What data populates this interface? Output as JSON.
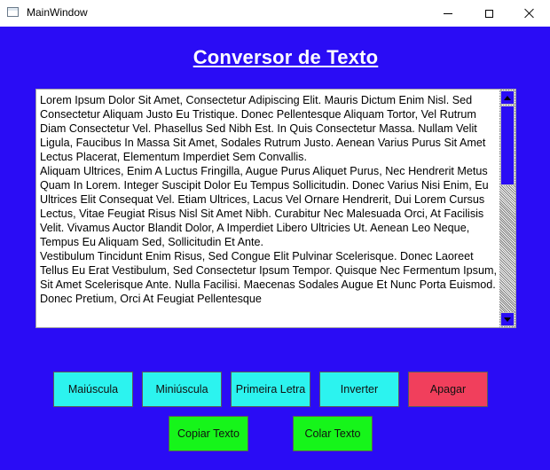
{
  "window": {
    "title": "MainWindow"
  },
  "app": {
    "title": "Conversor de Texto",
    "background_color": "#2a0cf5"
  },
  "editor": {
    "text": "Lorem Ipsum Dolor Sit Amet, Consectetur Adipiscing Elit. Mauris Dictum Enim Nisl. Sed Consectetur Aliquam Justo Eu Tristique. Donec Pellentesque Aliquam Tortor, Vel Rutrum Diam Consectetur Vel. Phasellus Sed Nibh Est. In Quis Consectetur Massa. Nullam Velit Ligula, Faucibus In Massa Sit Amet, Sodales Rutrum Justo. Aenean Varius Purus Sit Amet Lectus Placerat, Elementum Imperdiet Sem Convallis.\nAliquam Ultrices, Enim A Luctus Fringilla, Augue Purus Aliquet Purus, Nec Hendrerit Metus Quam In Lorem. Integer Suscipit Dolor Eu Tempus Sollicitudin. Donec Varius Nisi Enim, Eu Ultrices Elit Consequat Vel. Etiam Ultrices, Lacus Vel Ornare Hendrerit, Dui Lorem Cursus Lectus, Vitae Feugiat Risus Nisl Sit Amet Nibh. Curabitur Nec Malesuada Orci, At Facilisis Velit. Vivamus Auctor Blandit Dolor, A Imperdiet Libero Ultricies Ut. Aenean Leo Neque, Tempus Eu Aliquam Sed, Sollicitudin Et Ante.\nVestibulum Tincidunt Enim Risus, Sed Congue Elit Pulvinar Scelerisque. Donec Laoreet Tellus Eu Erat Vestibulum, Sed Consectetur Ipsum Tempor. Quisque Nec Fermentum Ipsum, Sit Amet Scelerisque Ante. Nulla Facilisi. Maecenas Sodales Augue Et Nunc Porta Euismod. Donec Pretium, Orci At Feugiat Pellentesque"
  },
  "buttons": {
    "maiuscula": "Maiúscula",
    "minuscula": "Miniúscula",
    "primeira_letra": "Primeira Letra",
    "inverter": "Inverter",
    "apagar": "Apagar",
    "copiar": "Copiar Texto",
    "colar": "Colar Texto"
  },
  "colors": {
    "cyan_button": "#2cf3ef",
    "red_button": "#f13f5c",
    "green_button": "#16f51a"
  }
}
